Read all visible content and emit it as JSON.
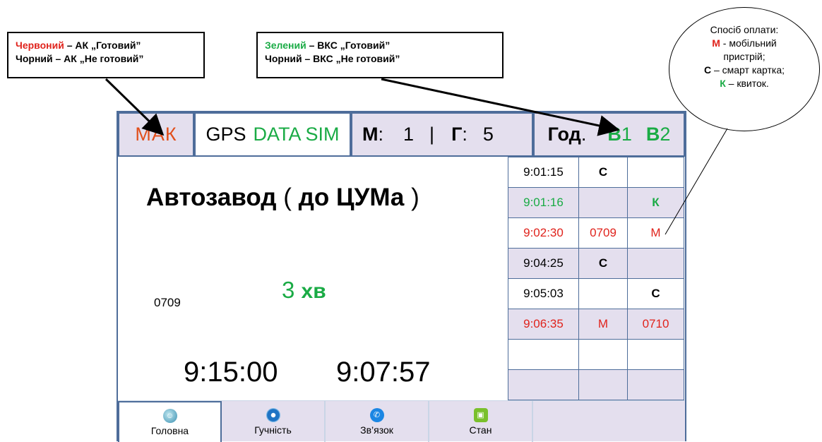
{
  "callouts": {
    "left": {
      "line1_color": "Червоний",
      "line1_rest": " – АК „Готовий”",
      "line2": "Чорний – АК „Не готовий”"
    },
    "mid": {
      "line1_color": "Зелений",
      "line1_rest": " – ВКС „Готовий”",
      "line2": "Чорний – ВКС „Не готовий”"
    },
    "payment": {
      "title": "Спосіб оплати:",
      "m_key": "М",
      "m_text": " - мобільний",
      "m_text2": "пристрій;",
      "c_key": "С",
      "c_text": " – смарт картка;",
      "k_key": "К",
      "k_text": " – квиток."
    }
  },
  "topbar": {
    "mak": "МАК",
    "gps": "GPS",
    "data_sim": "DATA SIM",
    "m_label": "М",
    "m_sep": ":",
    "m_value": "1",
    "divider": "|",
    "g_label": "Г",
    "g_sep": ":",
    "g_value": "5",
    "god_label": "Год",
    "god_dot": ".",
    "b1_letter": "В",
    "b1_num": "1",
    "b2_letter": "В",
    "b2_num": "2"
  },
  "main": {
    "route_name": "Автозавод",
    "route_open": "(",
    "route_to": "до ЦУМа",
    "route_close": ")",
    "eta_value": "3",
    "eta_unit": "хв",
    "bus_number": "0709",
    "time_planned": "9:15:00",
    "time_actual": "9:07:57"
  },
  "transactions": [
    {
      "time": "9:01:15",
      "b1": "С",
      "b2": "",
      "style": "plain"
    },
    {
      "time": "9:01:16",
      "b1": "",
      "b2": "К",
      "style": "green"
    },
    {
      "time": "9:02:30",
      "b1": "0709",
      "b2": "М",
      "style": "red"
    },
    {
      "time": "9:04:25",
      "b1": "С",
      "b2": "",
      "style": "plain"
    },
    {
      "time": "9:05:03",
      "b1": "",
      "b2": "С",
      "style": "plain"
    },
    {
      "time": "9:06:35",
      "b1": "М",
      "b2": "0710",
      "style": "red"
    },
    {
      "time": "",
      "b1": "",
      "b2": "",
      "style": "plain"
    },
    {
      "time": "",
      "b1": "",
      "b2": "",
      "style": "plain"
    }
  ],
  "bottom_tabs": [
    {
      "label": "Головна",
      "icon": "home-icon"
    },
    {
      "label": "Гучність",
      "icon": "volume-icon"
    },
    {
      "label": "Зв’язок",
      "icon": "phone-icon"
    },
    {
      "label": "Стан",
      "icon": "android-status-icon"
    }
  ],
  "colors": {
    "red": "#e0231c",
    "green": "#1aab45",
    "mak_orange": "#e14f1c",
    "panel_lilac": "#e4dfee",
    "border_blue": "#4e6d9a"
  }
}
